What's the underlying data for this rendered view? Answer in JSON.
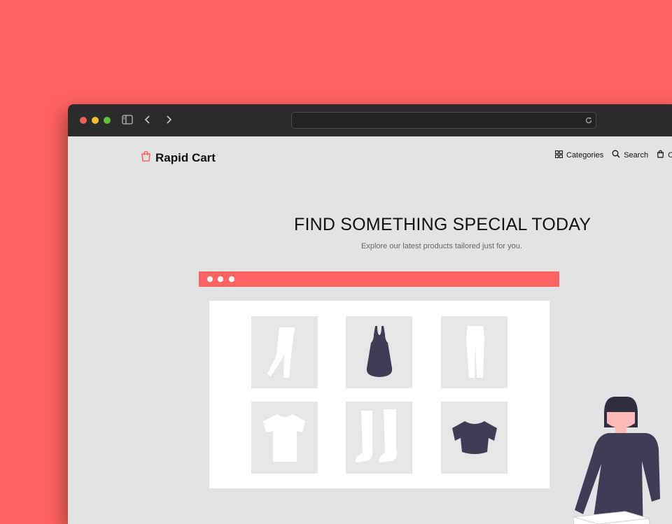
{
  "brand": {
    "name": "Rapid Cart",
    "accent": "#ff6361"
  },
  "nav": {
    "items": [
      {
        "label": "Categories",
        "icon": "grid-icon"
      },
      {
        "label": "Search",
        "icon": "search-icon"
      },
      {
        "label": "Ca",
        "icon": "bag-icon"
      }
    ]
  },
  "hero": {
    "title": "FIND SOMETHING SPECIAL TODAY",
    "subtitle": "Explore our latest products tailored just for you."
  },
  "illustration": {
    "products": [
      "pants",
      "dress",
      "trousers",
      "t-shirt",
      "boots",
      "crop-top"
    ]
  },
  "colors": {
    "background": "#ff6361",
    "titlebar": "#2c2b2b",
    "page": "#e3e3e6",
    "dark_item": "#3f3d56"
  }
}
